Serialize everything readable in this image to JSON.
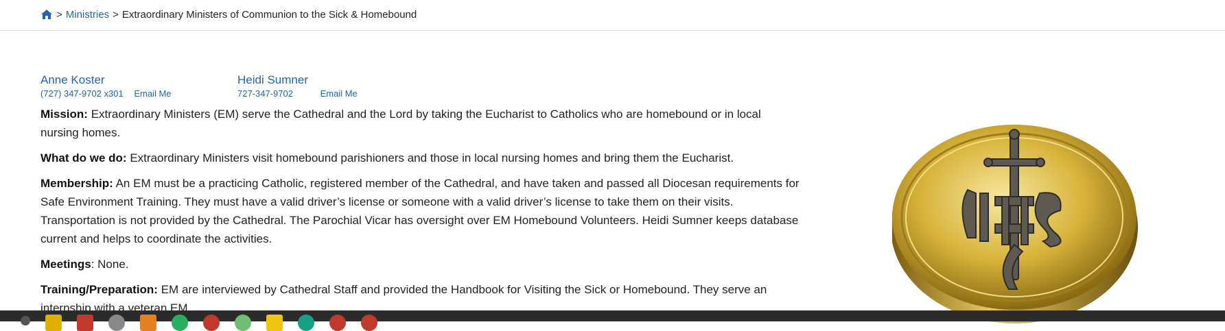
{
  "breadcrumb": {
    "home_icon": "home-icon",
    "separator": ">",
    "ministries": "Ministries",
    "current": "Extraordinary Ministers of Communion to the Sick & Homebound"
  },
  "contacts": [
    {
      "name": "Anne Koster",
      "phone": "(727) 347-9702 x301",
      "email_label": "Email Me"
    },
    {
      "name": "Heidi Sumner",
      "phone": "727-347-9702",
      "email_label": "Email Me"
    }
  ],
  "sections": {
    "mission": {
      "label": "Mission:",
      "text": "Extraordinary Ministers (EM) serve the Cathedral and the Lord by taking the Eucharist to Catholics who are homebound or in local nursing homes."
    },
    "what": {
      "label": "What do we do:",
      "text": "Extraordinary Ministers visit homebound parishioners and those in local nursing homes and bring them the Eucharist."
    },
    "membership": {
      "label": "Membership:",
      "text": "An EM must be a practicing Catholic, registered member of the Cathedral, and have taken and passed all Diocesan requirements for Safe Environment Training.  They must have a valid driver’s license or someone with a valid driver’s license to take them on their visits. Transportation is not provided by the Cathedral. The Parochial Vicar has oversight over EM Homebound Volunteers. Heidi Sumner keeps database current and helps to coordinate the activities."
    },
    "meetings": {
      "label": "Meetings",
      "text": ": None."
    },
    "training": {
      "label": "Training/Preparation:",
      "text": "EM are interviewed by Cathedral Staff and provided the Handbook for Visiting the Sick or Homebound.  They serve an internship with a veteran EM."
    }
  },
  "colors": {
    "link": "#2266a8",
    "taskbar": "#2b2b2b",
    "gold": "#d9b43c"
  }
}
